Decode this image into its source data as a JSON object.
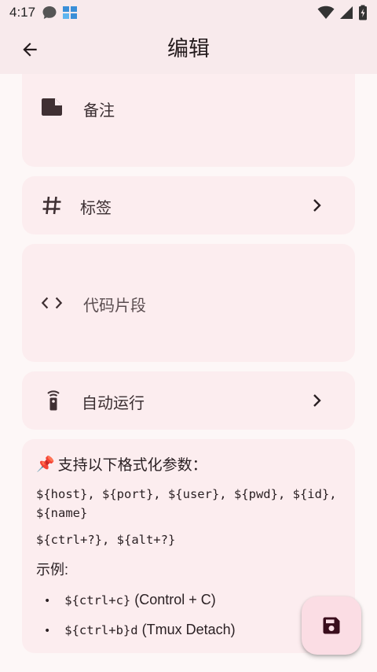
{
  "status_bar": {
    "time": "4:17"
  },
  "app_bar": {
    "title": "编辑"
  },
  "rows": {
    "note": "备注",
    "tags": "标签",
    "snippet": "代码片段",
    "autorun": "自动运行"
  },
  "info": {
    "title_emoji": "📌",
    "title": "支持以下格式化参数：",
    "params_line": "${host}, ${port}, ${user}, ${pwd}, ${id}, ${name}",
    "keys_line": "${ctrl+?}, ${alt+?}",
    "example_label": "示例:",
    "examples": [
      {
        "code": "${ctrl+c}",
        "desc": " (Control + C)"
      },
      {
        "code": "${ctrl+b}d",
        "desc": " (Tmux Detach)"
      }
    ]
  },
  "colors": {
    "background": "#fdf7f7",
    "card": "#fcedef",
    "app_bar": "#f8eaec",
    "fab": "#fbdde4",
    "icon": "#3f3033"
  }
}
